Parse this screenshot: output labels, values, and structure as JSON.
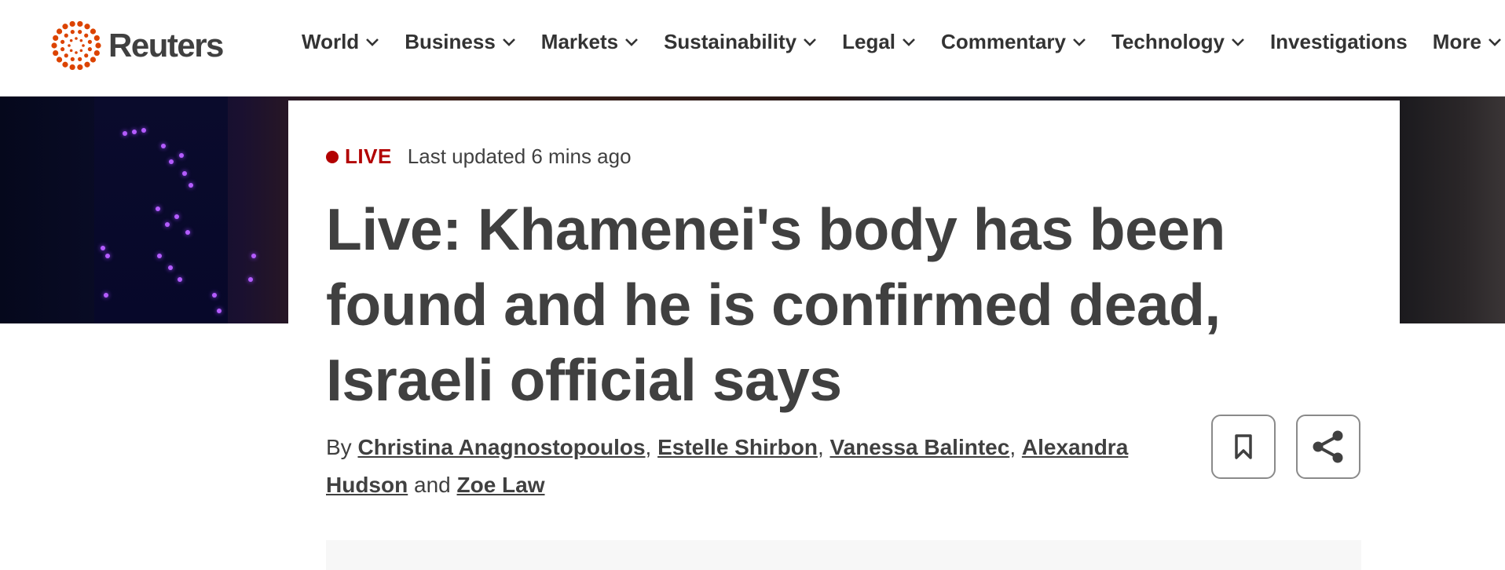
{
  "brand": {
    "name": "Reuters",
    "accent": "#dc4300"
  },
  "nav": {
    "items": [
      {
        "label": "World",
        "has_dropdown": true
      },
      {
        "label": "Business",
        "has_dropdown": true
      },
      {
        "label": "Markets",
        "has_dropdown": true
      },
      {
        "label": "Sustainability",
        "has_dropdown": true
      },
      {
        "label": "Legal",
        "has_dropdown": true
      },
      {
        "label": "Commentary",
        "has_dropdown": true
      },
      {
        "label": "Technology",
        "has_dropdown": true
      },
      {
        "label": "Investigations",
        "has_dropdown": false
      },
      {
        "label": "More",
        "has_dropdown": true
      }
    ]
  },
  "article": {
    "live_label": "LIVE",
    "live_color": "#b20000",
    "updated": "Last updated 6 mins ago",
    "headline": "Live: Khamenei's body has been found and he is confirmed dead, Israeli official says",
    "byline": {
      "prefix": "By",
      "authors": [
        "Christina Anagnostopoulos",
        "Estelle Shirbon",
        "Vanessa Balintec",
        "Alexandra Hudson",
        "Zoe Law"
      ],
      "separator": ",",
      "conjunction": "and"
    }
  },
  "actions": {
    "bookmark_icon": "bookmark-icon",
    "share_icon": "share-icon"
  }
}
